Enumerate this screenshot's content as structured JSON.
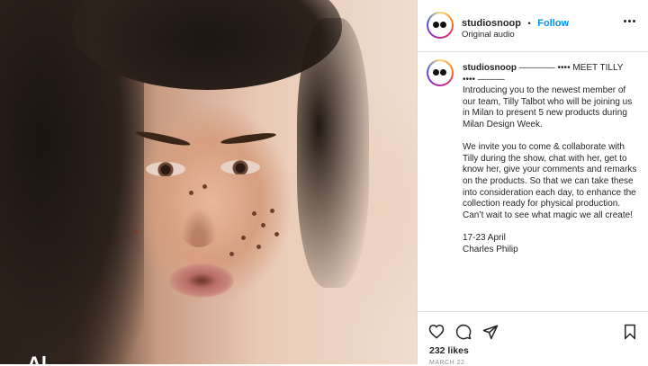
{
  "post": {
    "author": "studiosnoop",
    "separator": "•",
    "follow_label": "Follow",
    "audio": "Original audio",
    "more_icon": "more-horizontal-icon"
  },
  "caption": {
    "author": "studiosnoop",
    "headline_1": "———— •••• MEET TILLY",
    "headline_2": "•••• ———",
    "para1": "Introducing you to the newest member of our team, Tilly Talbot who will be joining us in Milan to present 5 new products during Milan Design Week.",
    "para2": "We invite you to come & collaborate with Tilly during the show, chat with her, get to know her, give your comments and remarks on the products. So that we can take these into consideration each day, to enhance the collection ready for physical production. Can’t wait to see what magic we all create!",
    "dates": "17-23 April",
    "signature": "Charles Philip"
  },
  "actions": {
    "icons": [
      "heart-icon",
      "comment-icon",
      "share-icon",
      "bookmark-icon"
    ],
    "likes": "232 likes",
    "date": "MARCH 22"
  },
  "media": {
    "caption_fragment": "Al"
  }
}
